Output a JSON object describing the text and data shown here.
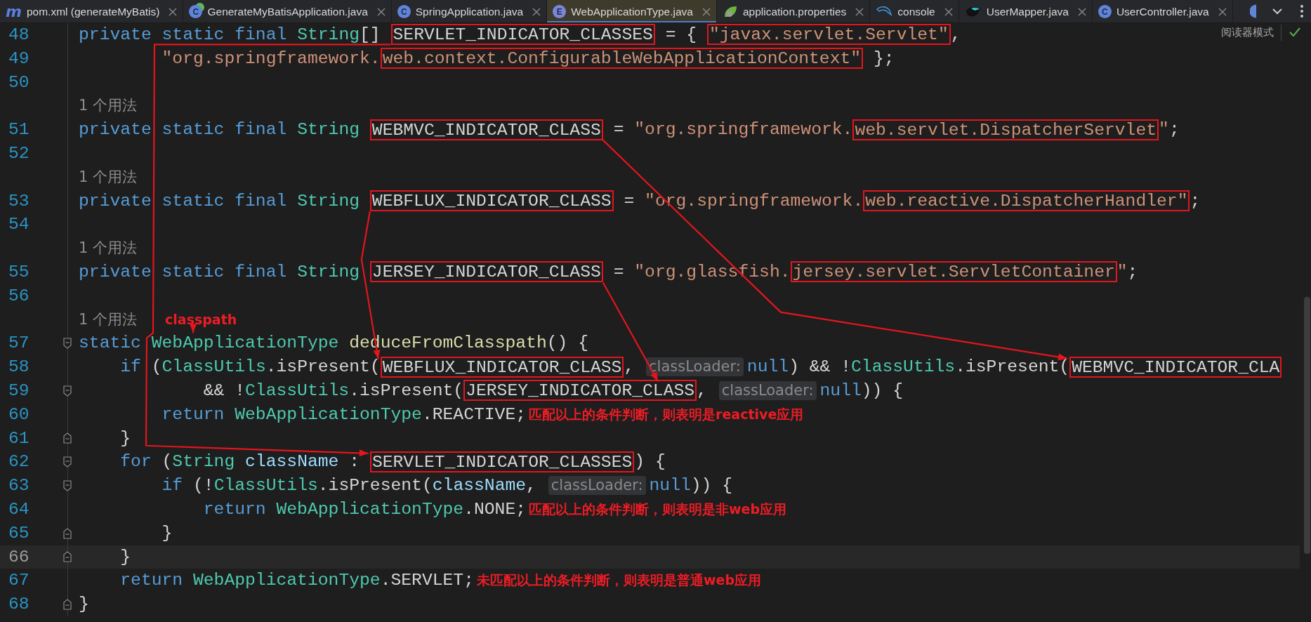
{
  "tabs": [
    {
      "label": "pom.xml (generateMyBatis)",
      "selected": false,
      "icon": {
        "kind": "letter",
        "glyph": "m"
      }
    },
    {
      "label": "GenerateMyBatisApplication.java",
      "selected": false,
      "icon": {
        "kind": "spring-class",
        "glyph": "C"
      }
    },
    {
      "label": "SpringApplication.java",
      "selected": false,
      "icon": {
        "kind": "class",
        "glyph": "C"
      }
    },
    {
      "label": "WebApplicationType.java",
      "selected": true,
      "icon": {
        "kind": "enum",
        "glyph": "E"
      }
    },
    {
      "label": "application.properties",
      "selected": false,
      "icon": {
        "kind": "leaf"
      }
    },
    {
      "label": "console",
      "selected": false,
      "icon": {
        "kind": "dolphin"
      }
    },
    {
      "label": "UserMapper.java",
      "selected": false,
      "icon": {
        "kind": "bird"
      }
    },
    {
      "label": "UserController.java",
      "selected": false,
      "icon": {
        "kind": "class",
        "glyph": "C"
      }
    }
  ],
  "editor": {
    "reader_mode": "阅读器模式",
    "lines": [
      {
        "kind": "code",
        "number": "48",
        "current": false,
        "tokens": [
          {
            "kind": "keyword",
            "text": "private static final ",
            "boxed": false
          },
          {
            "kind": "type",
            "text": "String",
            "boxed": false
          },
          {
            "kind": "plain",
            "text": "[] ",
            "boxed": false
          },
          {
            "kind": "plain",
            "text": "SERVLET_INDICATOR_CLASSES",
            "boxed": true
          },
          {
            "kind": "plain",
            "text": " = { ",
            "boxed": false
          },
          {
            "kind": "string",
            "text": "\"javax.servlet.Servlet\"",
            "boxed": true
          },
          {
            "kind": "plain",
            "text": ",",
            "boxed": false
          }
        ]
      },
      {
        "kind": "code",
        "number": "49",
        "current": false,
        "tokens": [
          {
            "kind": "string",
            "text": "        \"org.springframework.",
            "boxed": false
          },
          {
            "kind": "string",
            "text": "web.context.ConfigurableWebApplicationContext\"",
            "boxed": true
          },
          {
            "kind": "plain",
            "text": " };",
            "boxed": false
          }
        ]
      },
      {
        "kind": "code",
        "number": "50",
        "current": false
      },
      {
        "kind": "usages",
        "text": "1 个用法"
      },
      {
        "kind": "code",
        "number": "51",
        "current": false,
        "tokens": [
          {
            "kind": "keyword",
            "text": "private static final ",
            "boxed": false
          },
          {
            "kind": "type",
            "text": "String ",
            "boxed": false
          },
          {
            "kind": "plain",
            "text": "WEBMVC_INDICATOR_CLASS",
            "boxed": true
          },
          {
            "kind": "plain",
            "text": " = ",
            "boxed": false
          },
          {
            "kind": "string",
            "text": "\"org.springframework.",
            "boxed": false
          },
          {
            "kind": "string",
            "text": "web.servlet.DispatcherServlet",
            "boxed": true
          },
          {
            "kind": "string",
            "text": "\"",
            "boxed": false
          },
          {
            "kind": "plain",
            "text": ";",
            "boxed": false
          }
        ]
      },
      {
        "kind": "code",
        "number": "52",
        "current": false
      },
      {
        "kind": "usages",
        "text": "1 个用法"
      },
      {
        "kind": "code",
        "number": "53",
        "current": false,
        "tokens": [
          {
            "kind": "keyword",
            "text": "private static final ",
            "boxed": false
          },
          {
            "kind": "type",
            "text": "String ",
            "boxed": false
          },
          {
            "kind": "plain",
            "text": "WEBFLUX_INDICATOR_CLASS",
            "boxed": true
          },
          {
            "kind": "plain",
            "text": " = ",
            "boxed": false
          },
          {
            "kind": "string",
            "text": "\"org.springframework.",
            "boxed": false
          },
          {
            "kind": "string",
            "text": "web.reactive.DispatcherHandler\"",
            "boxed": true
          },
          {
            "kind": "plain",
            "text": ";",
            "boxed": false
          }
        ]
      },
      {
        "kind": "code",
        "number": "54",
        "current": false
      },
      {
        "kind": "usages",
        "text": "1 个用法"
      },
      {
        "kind": "code",
        "number": "55",
        "current": false,
        "tokens": [
          {
            "kind": "keyword",
            "text": "private static final ",
            "boxed": false
          },
          {
            "kind": "type",
            "text": "String ",
            "boxed": false
          },
          {
            "kind": "plain",
            "text": "JERSEY_INDICATOR_CLASS",
            "boxed": true
          },
          {
            "kind": "plain",
            "text": " = ",
            "boxed": false
          },
          {
            "kind": "string",
            "text": "\"org.glassfish.",
            "boxed": false
          },
          {
            "kind": "string",
            "text": "jersey.servlet.ServletContainer",
            "boxed": true
          },
          {
            "kind": "string",
            "text": "\"",
            "boxed": false
          },
          {
            "kind": "plain",
            "text": ";",
            "boxed": false
          }
        ]
      },
      {
        "kind": "code",
        "number": "56",
        "current": false
      },
      {
        "kind": "usages",
        "text": "1 个用法",
        "annotation": "classpath"
      },
      {
        "kind": "code",
        "number": "57",
        "current": false,
        "fold": {
          "kind": "start"
        },
        "tokens": [
          {
            "kind": "keyword",
            "text": "static ",
            "boxed": false
          },
          {
            "kind": "type",
            "text": "WebApplicationType ",
            "boxed": false
          },
          {
            "kind": "method",
            "text": "deduceFromClasspath",
            "boxed": false
          },
          {
            "kind": "plain",
            "text": "() {",
            "boxed": false
          }
        ]
      },
      {
        "kind": "code",
        "number": "58",
        "current": false,
        "tokens": [
          {
            "kind": "keyword",
            "text": "    if",
            "boxed": false
          },
          {
            "kind": "plain",
            "text": " (",
            "boxed": false
          },
          {
            "kind": "type",
            "text": "ClassUtils",
            "boxed": false
          },
          {
            "kind": "plain",
            "text": ".isPresent(",
            "boxed": false
          },
          {
            "kind": "plain",
            "text": "WEBFLUX_INDICATOR_CLASS",
            "boxed": true
          },
          {
            "kind": "plain",
            "text": ", ",
            "boxed": false
          },
          {
            "kind": "hint",
            "text": "classLoader:",
            "boxed": false
          },
          {
            "kind": "keyword",
            "text": "null",
            "boxed": false
          },
          {
            "kind": "plain",
            "text": ") && !",
            "boxed": false
          },
          {
            "kind": "type",
            "text": "ClassUtils",
            "boxed": false
          },
          {
            "kind": "plain",
            "text": ".isPresent(",
            "boxed": false
          },
          {
            "kind": "plain",
            "text": "WEBMVC_INDICATOR_CLA",
            "boxed": true
          }
        ]
      },
      {
        "kind": "code",
        "number": "59",
        "current": false,
        "fold": {
          "kind": "start"
        },
        "tokens": [
          {
            "kind": "plain",
            "text": "            && !",
            "boxed": false
          },
          {
            "kind": "type",
            "text": "ClassUtils",
            "boxed": false
          },
          {
            "kind": "plain",
            "text": ".isPresent(",
            "boxed": false
          },
          {
            "kind": "plain",
            "text": "JERSEY_INDICATOR_CLASS",
            "boxed": true
          },
          {
            "kind": "plain",
            "text": ", ",
            "boxed": false
          },
          {
            "kind": "hint",
            "text": "classLoader:",
            "boxed": false
          },
          {
            "kind": "keyword",
            "text": "null",
            "boxed": false
          },
          {
            "kind": "plain",
            "text": ")) {",
            "boxed": false
          }
        ]
      },
      {
        "kind": "code",
        "number": "60",
        "current": false,
        "note": "匹配以上的条件判断，则表明是reactive应用",
        "tokens": [
          {
            "kind": "keyword",
            "text": "        return ",
            "boxed": false
          },
          {
            "kind": "type",
            "text": "WebApplicationType",
            "boxed": false
          },
          {
            "kind": "plain",
            "text": ".REACTIVE;",
            "boxed": false
          }
        ]
      },
      {
        "kind": "code",
        "number": "61",
        "current": false,
        "fold": {
          "kind": "end"
        },
        "tokens": [
          {
            "kind": "plain",
            "text": "    }",
            "boxed": false
          }
        ]
      },
      {
        "kind": "code",
        "number": "62",
        "current": false,
        "fold": {
          "kind": "start"
        },
        "tokens": [
          {
            "kind": "keyword",
            "text": "    for",
            "boxed": false
          },
          {
            "kind": "plain",
            "text": " (",
            "boxed": false
          },
          {
            "kind": "type",
            "text": "String ",
            "boxed": false
          },
          {
            "kind": "variable",
            "text": "className",
            "boxed": false
          },
          {
            "kind": "plain",
            "text": " : ",
            "boxed": false
          },
          {
            "kind": "plain",
            "text": "SERVLET_INDICATOR_CLASSES",
            "boxed": true
          },
          {
            "kind": "plain",
            "text": ") {",
            "boxed": false
          }
        ]
      },
      {
        "kind": "code",
        "number": "63",
        "current": false,
        "fold": {
          "kind": "start"
        },
        "tokens": [
          {
            "kind": "keyword",
            "text": "        if",
            "boxed": false
          },
          {
            "kind": "plain",
            "text": " (!",
            "boxed": false
          },
          {
            "kind": "type",
            "text": "ClassUtils",
            "boxed": false
          },
          {
            "kind": "plain",
            "text": ".isPresent(",
            "boxed": false
          },
          {
            "kind": "variable",
            "text": "className",
            "boxed": false
          },
          {
            "kind": "plain",
            "text": ", ",
            "boxed": false
          },
          {
            "kind": "hint",
            "text": "classLoader:",
            "boxed": false
          },
          {
            "kind": "keyword",
            "text": "null",
            "boxed": false
          },
          {
            "kind": "plain",
            "text": ")) {",
            "boxed": false
          }
        ]
      },
      {
        "kind": "code",
        "number": "64",
        "current": false,
        "note": "匹配以上的条件判断，则表明是非web应用",
        "tokens": [
          {
            "kind": "keyword",
            "text": "            return ",
            "boxed": false
          },
          {
            "kind": "type",
            "text": "WebApplicationType",
            "boxed": false
          },
          {
            "kind": "plain",
            "text": ".NONE;",
            "boxed": false
          }
        ]
      },
      {
        "kind": "code",
        "number": "65",
        "current": false,
        "fold": {
          "kind": "end"
        },
        "tokens": [
          {
            "kind": "plain",
            "text": "        }",
            "boxed": false
          }
        ]
      },
      {
        "kind": "code",
        "number": "66",
        "current": true,
        "fold": {
          "kind": "end"
        },
        "tokens": [
          {
            "kind": "plain",
            "text": "    }",
            "boxed": false
          }
        ]
      },
      {
        "kind": "code",
        "number": "67",
        "current": false,
        "note": "未匹配以上的条件判断，则表明是普通web应用",
        "tokens": [
          {
            "kind": "keyword",
            "text": "    return ",
            "boxed": false
          },
          {
            "kind": "type",
            "text": "WebApplicationType",
            "boxed": false
          },
          {
            "kind": "plain",
            "text": ".SERVLET;",
            "boxed": false
          }
        ]
      },
      {
        "kind": "code",
        "number": "68",
        "current": false,
        "fold": {
          "kind": "end"
        },
        "tokens": [
          {
            "kind": "plain",
            "text": "}",
            "boxed": false
          }
        ]
      }
    ]
  }
}
